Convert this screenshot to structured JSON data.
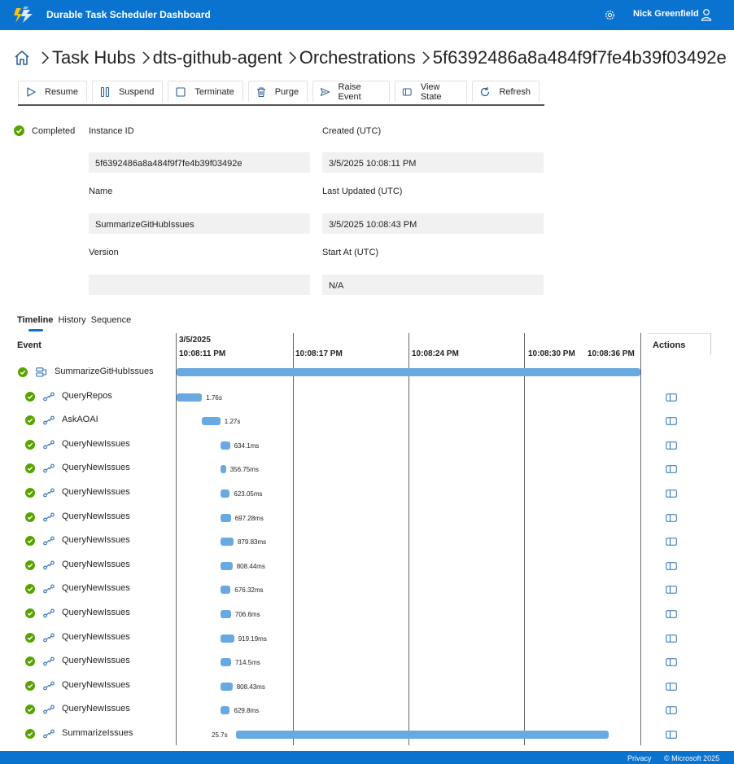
{
  "app": {
    "title": "Durable Task Scheduler Dashboard",
    "user_name": "Nick Greenfield"
  },
  "breadcrumb": {
    "items": [
      "Task Hubs",
      "dts-github-agent",
      "Orchestrations",
      "5f6392486a8a484f9f7fe4b39f03492e"
    ]
  },
  "toolbar": {
    "resume": "Resume",
    "suspend": "Suspend",
    "terminate": "Terminate",
    "purge": "Purge",
    "raise_event": "Raise Event",
    "view_state": "View State",
    "refresh": "Refresh"
  },
  "details": {
    "status": "Completed",
    "instance_id_label": "Instance ID",
    "instance_id": "5f6392486a8a484f9f7fe4b39f03492e",
    "name_label": "Name",
    "name": "SummarizeGitHubIssues",
    "version_label": "Version",
    "version": "",
    "created_label": "Created (UTC)",
    "created": "3/5/2025 10:08:11 PM",
    "last_updated_label": "Last Updated (UTC)",
    "last_updated": "3/5/2025 10:08:43 PM",
    "start_at_label": "Start At (UTC)",
    "start_at": "N/A"
  },
  "tabs": [
    "Timeline",
    "History",
    "Sequence"
  ],
  "timeline": {
    "event_header": "Event",
    "actions_header": "Actions",
    "date": "3/5/2025",
    "ticks": [
      "10:08:11 PM",
      "10:08:17 PM",
      "10:08:24 PM",
      "10:08:30 PM",
      "10:08:36 PM"
    ],
    "rows": [
      {
        "name": "SummarizeGitHubIssues",
        "kind": "orchestration",
        "start_s": 0.0,
        "duration_s": 32.0,
        "duration_label": ""
      },
      {
        "name": "QueryRepos",
        "kind": "activity",
        "start_s": 0.0,
        "duration_s": 1.76,
        "duration_label": "1.76s"
      },
      {
        "name": "AskAOAI",
        "kind": "activity",
        "start_s": 1.75,
        "duration_s": 1.27,
        "duration_label": "1.27s"
      },
      {
        "name": "QueryNewIssues",
        "kind": "activity",
        "start_s": 3.05,
        "duration_s": 0.6341,
        "duration_label": "634.1ms"
      },
      {
        "name": "QueryNewIssues",
        "kind": "activity",
        "start_s": 3.05,
        "duration_s": 0.35675,
        "duration_label": "356.75ms"
      },
      {
        "name": "QueryNewIssues",
        "kind": "activity",
        "start_s": 3.05,
        "duration_s": 0.62305,
        "duration_label": "623.05ms"
      },
      {
        "name": "QueryNewIssues",
        "kind": "activity",
        "start_s": 3.05,
        "duration_s": 0.69728,
        "duration_label": "697.28ms"
      },
      {
        "name": "QueryNewIssues",
        "kind": "activity",
        "start_s": 3.05,
        "duration_s": 0.87983,
        "duration_label": "879.83ms"
      },
      {
        "name": "QueryNewIssues",
        "kind": "activity",
        "start_s": 3.05,
        "duration_s": 0.80844,
        "duration_label": "808.44ms"
      },
      {
        "name": "QueryNewIssues",
        "kind": "activity",
        "start_s": 3.05,
        "duration_s": 0.67632,
        "duration_label": "676.32ms"
      },
      {
        "name": "QueryNewIssues",
        "kind": "activity",
        "start_s": 3.05,
        "duration_s": 0.7066,
        "duration_label": "706.6ms"
      },
      {
        "name": "QueryNewIssues",
        "kind": "activity",
        "start_s": 3.05,
        "duration_s": 0.91919,
        "duration_label": "919.19ms"
      },
      {
        "name": "QueryNewIssues",
        "kind": "activity",
        "start_s": 3.05,
        "duration_s": 0.7145,
        "duration_label": "714.5ms"
      },
      {
        "name": "QueryNewIssues",
        "kind": "activity",
        "start_s": 3.05,
        "duration_s": 0.80843,
        "duration_label": "808.43ms"
      },
      {
        "name": "QueryNewIssues",
        "kind": "activity",
        "start_s": 3.05,
        "duration_s": 0.6298,
        "duration_label": "629.8ms"
      },
      {
        "name": "SummarizeIssues",
        "kind": "activity",
        "start_s": 4.1,
        "duration_s": 25.7,
        "duration_label": "25.7s"
      }
    ]
  },
  "footer": {
    "privacy": "Privacy",
    "copyright": "© Microsoft 2025"
  },
  "colors": {
    "brand": "#0a72cf",
    "success": "#57a300",
    "bar": "#69a9e2"
  }
}
